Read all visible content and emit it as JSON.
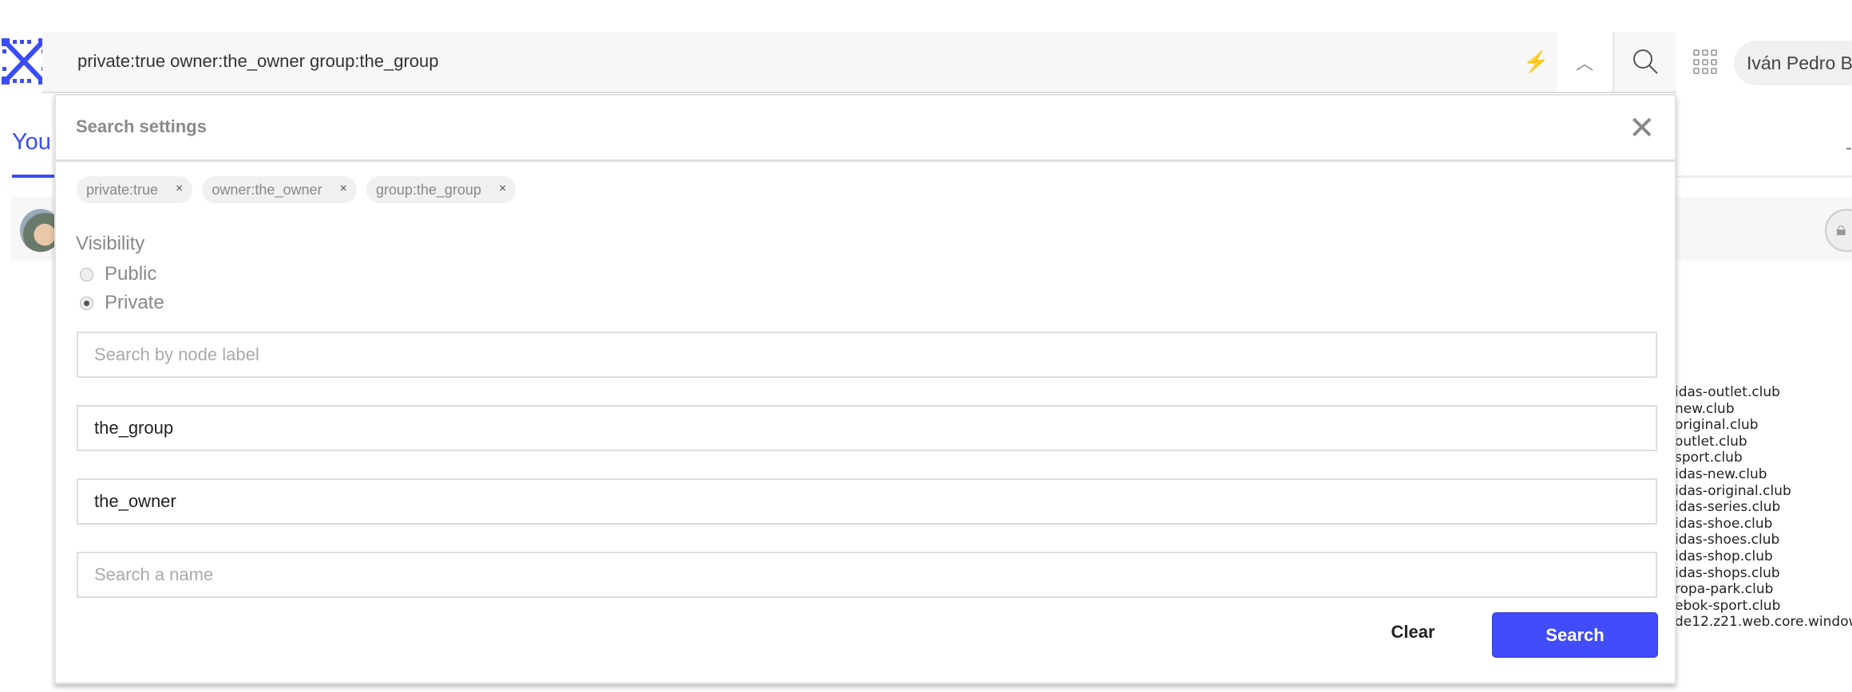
{
  "header": {
    "search_query": "private:true owner:the_owner group:the_group",
    "user_name": "Iván Pedro B...",
    "icons": [
      "logo-icon",
      "bolt-icon",
      "chevron-up-icon",
      "search-icon",
      "apps-grid-icon"
    ]
  },
  "background": {
    "tab_label": "You",
    "domains": [
      "idas-outlet.club",
      "new.club",
      "original.club",
      "outlet.club",
      "sport.club",
      "idas-new.club",
      "idas-original.club",
      "idas-series.club",
      "idas-shoe.club",
      "idas-shoes.club",
      "idas-shop.club",
      "idas-shops.club",
      "ropa-park.club",
      "ebok-sport.club",
      "de12.z21.web.core.window"
    ]
  },
  "modal": {
    "title": "Search settings",
    "chips": [
      "private:true",
      "owner:the_owner",
      "group:the_group"
    ],
    "chip_remove": "×",
    "visibility_label": "Visibility",
    "visibility_options": [
      "Public",
      "Private"
    ],
    "visibility_selected": "Private",
    "node_label": {
      "value": "",
      "placeholder": "Search by node label"
    },
    "group": {
      "value": "the_group",
      "placeholder": ""
    },
    "owner": {
      "value": "the_owner",
      "placeholder": ""
    },
    "name": {
      "value": "",
      "placeholder": "Search a name"
    },
    "clear_label": "Clear",
    "search_label": "Search"
  },
  "colors": {
    "accent": "#414cfb"
  }
}
